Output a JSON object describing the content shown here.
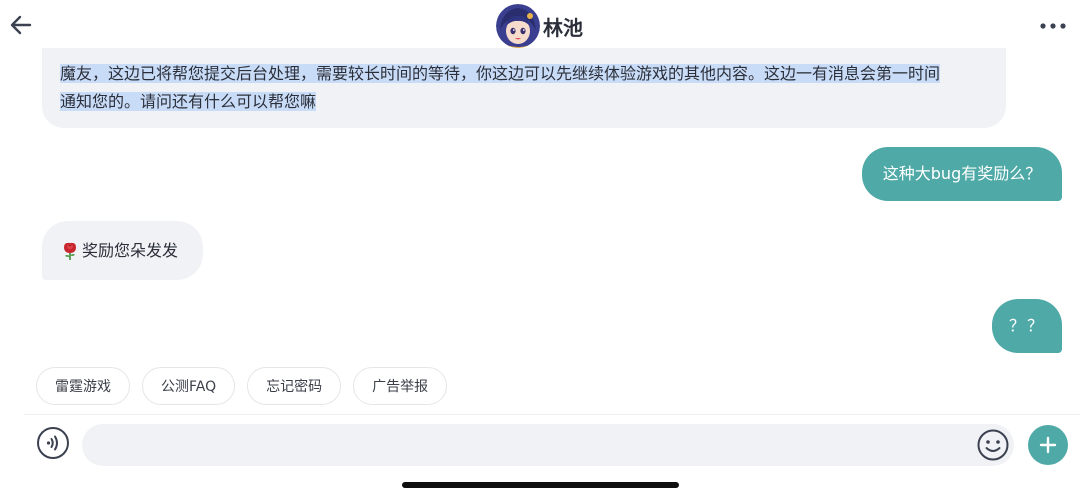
{
  "header": {
    "title": "林池",
    "back_icon": "arrow-left-icon",
    "more_icon": "ellipsis-icon"
  },
  "messages": [
    {
      "side": "left",
      "text": "魔友，这边已将帮您提交后台处理，需要较长时间的等待，你这边可以先继续体验游戏的其他内容。这边一有消息会第一时间通知您的。请问还有什么可以帮您嘛",
      "line1": "魔友，这边已将帮您提交后台处理，需要较长时间的等待，你这边可以先继续体验游戏的其他内容。这边一有消息会第一时间",
      "line2": "通知您的。请问还有什么可以帮您嘛",
      "highlighted": true
    },
    {
      "side": "right",
      "text": "这种大bug有奖励么？"
    },
    {
      "side": "left",
      "emoji": "rose-icon",
      "text": "奖励您朵发发"
    },
    {
      "side": "right",
      "text": "？？"
    }
  ],
  "quick_replies": [
    "雷霆游戏",
    "公测FAQ",
    "忘记密码",
    "广告举报"
  ],
  "input": {
    "value": "",
    "placeholder": ""
  },
  "colors": {
    "accent": "#4ea9a7",
    "bubble_left": "#f1f2f5",
    "selection": "#c9dcf7",
    "text": "#2b2f3a"
  }
}
